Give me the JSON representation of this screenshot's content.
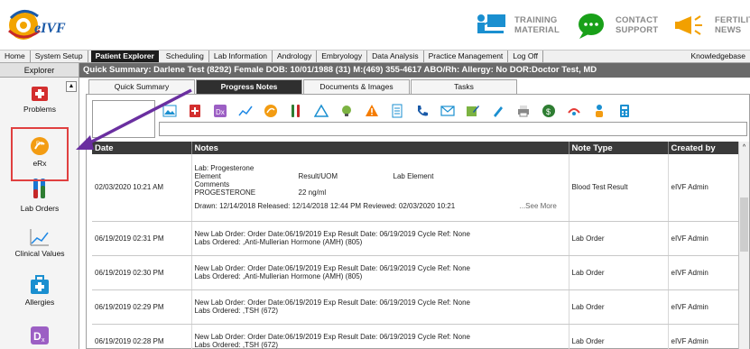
{
  "logo": {
    "text": "eIVF"
  },
  "banner": {
    "training": {
      "line1": "TRAINING",
      "line2": "MATERIAL"
    },
    "contact": {
      "line1": "CONTACT",
      "line2": "SUPPORT"
    },
    "fertility": {
      "line1": "FERTILIT",
      "line2": "NEWS"
    }
  },
  "menu": {
    "home": "Home",
    "system_setup": "System Setup",
    "patient_explorer": "Patient Explorer",
    "scheduling": "Scheduling",
    "lab_information": "Lab Information",
    "andrology": "Andrology",
    "embryology": "Embryology",
    "data_analysis": "Data Analysis",
    "practice_management": "Practice Management",
    "log_off": "Log Off",
    "knowledgebase": "Knowledgebase"
  },
  "sidebar": {
    "header": "Explorer",
    "items": [
      {
        "label": "Problems",
        "icon": "red-cross-icon"
      },
      {
        "label": "eRx",
        "icon": "erx-icon"
      },
      {
        "label": "Lab Orders",
        "icon": "test-tubes-icon"
      },
      {
        "label": "Clinical Values",
        "icon": "chart-line-icon"
      },
      {
        "label": "Allergies",
        "icon": "medkit-icon"
      },
      {
        "label": "Dx",
        "icon": "dx-icon"
      }
    ]
  },
  "quick_summary": "Quick Summary:  Darlene Test (8292)  Female  DOB: 10/01/1988 (31)  M:(469) 355-4617  ABO/Rh:   Allergy: No   DOR:Doctor Test, MD",
  "tabs": [
    "Quick Summary",
    "Progress Notes",
    "Documents & Images",
    "Tasks"
  ],
  "active_tab": "Progress Notes",
  "table": {
    "columns": [
      "Date",
      "Notes",
      "Note Type",
      "Created by"
    ],
    "first_row": {
      "date": "02/03/2020 10:21 AM",
      "lines": [
        "Lab: Progesterone"
      ],
      "element_label": "Element",
      "result_label": "Result/UOM",
      "lab_element_label": "Lab Element",
      "comments_label": "Comments",
      "analyte": "PROGESTERONE",
      "value": "22 ng/ml",
      "drawn": "Drawn: 12/14/2018   Released: 12/14/2018 12:44 PM   Reviewed: 02/03/2020 10:21",
      "see_more": "...See More",
      "note_type": "Blood Test Result",
      "created_by": "eIVF Admin"
    },
    "rows": [
      {
        "date": "06/19/2019 02:31 PM",
        "line1": "New Lab Order: Order Date:06/19/2019 Exp Result Date: 06/19/2019 Cycle Ref: None",
        "line2": "Labs Ordered: ,Anti-Mullerian Hormone (AMH) (805)",
        "note_type": "Lab Order",
        "created_by": "eIVF Admin"
      },
      {
        "date": "06/19/2019 02:30 PM",
        "line1": "New Lab Order: Order Date:06/19/2019 Exp Result Date: 06/19/2019 Cycle Ref: None",
        "line2": "Labs Ordered: ,Anti-Mullerian Hormone (AMH) (805)",
        "note_type": "Lab Order",
        "created_by": "eIVF Admin"
      },
      {
        "date": "06/19/2019 02:29 PM",
        "line1": "New Lab Order: Order Date:06/19/2019 Exp Result Date: 06/19/2019 Cycle Ref: None",
        "line2": "Labs Ordered: ,TSH (672)",
        "note_type": "Lab Order",
        "created_by": "eIVF Admin"
      },
      {
        "date": "06/19/2019 02:28 PM",
        "line1": "New Lab Order: Order Date:06/19/2019 Exp Result Date: 06/19/2019 Cycle Ref: None",
        "line2": "Labs Ordered: ,TSH (672)",
        "note_type": "Lab Order",
        "created_by": "eIVF Admin"
      }
    ]
  },
  "colors": {
    "annotation_arrow": "#6a2fa0",
    "highlight_box": "#e04040",
    "header_dark": "#3a3a3a"
  }
}
